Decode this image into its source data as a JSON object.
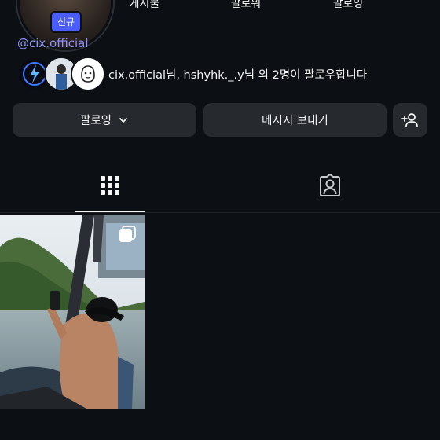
{
  "profile": {
    "badge": "신규",
    "handle": "@cix.official"
  },
  "stats": {
    "posts_label": "게시물",
    "followers_label": "팔로워",
    "following_label": "팔로잉"
  },
  "mutual": {
    "text": "cix.official님, hshyhk._.y님 외 2명이 팔로우합니다"
  },
  "actions": {
    "following_label": "팔로잉",
    "message_label": "메시지 보내기"
  },
  "tabs": {
    "grid_icon": "grid-icon",
    "tagged_icon": "tagged-person-icon"
  },
  "colors": {
    "background": "#0c1014",
    "button": "#26292e",
    "badge": "#4a5df9",
    "handle": "#8f93f8"
  }
}
